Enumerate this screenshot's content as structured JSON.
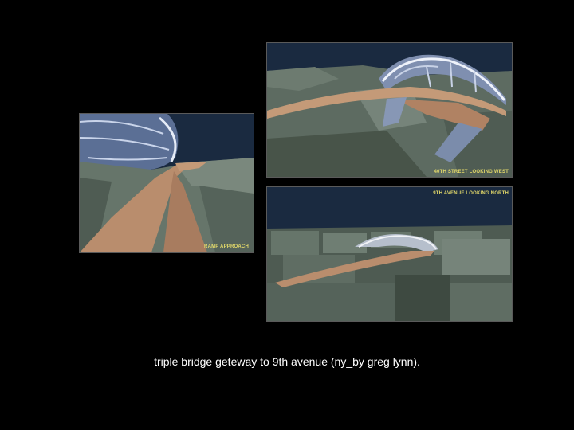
{
  "slide": {
    "caption": "triple bridge geteway to 9th avenue (ny_by greg lynn)."
  },
  "images": [
    {
      "id": "ramp-approach",
      "label": "RAMP APPROACH"
    },
    {
      "id": "40th-street",
      "label": "40TH STREET LOOKING WEST"
    },
    {
      "id": "9th-avenue",
      "label": "9TH AVENUE LOOKING NORTH"
    }
  ],
  "colors": {
    "background": "#000000",
    "sky": "#1c2b40",
    "buildings": "#5f6d63",
    "bridge_deck": "#c49a78",
    "label_text": "#e3d96a",
    "caption_text": "#ffffff"
  }
}
